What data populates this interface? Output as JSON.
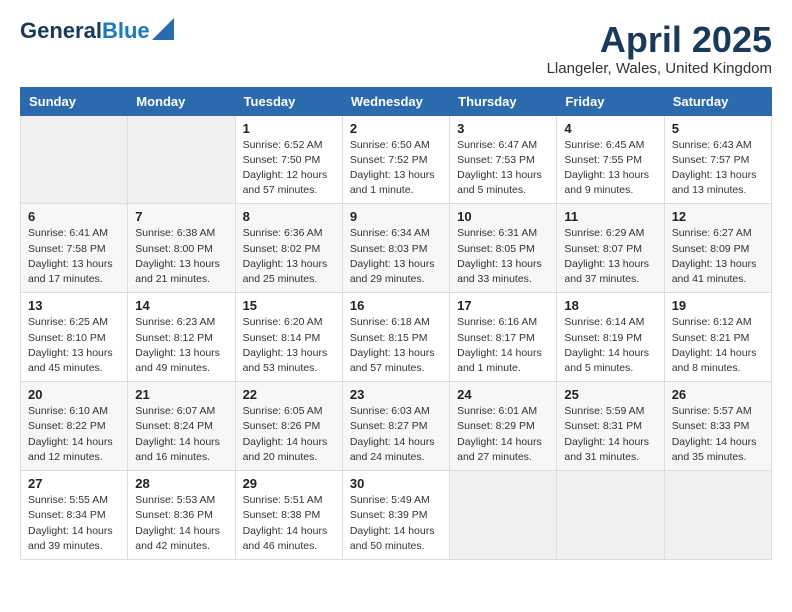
{
  "header": {
    "logo_line1": "General",
    "logo_line2": "Blue",
    "month_title": "April 2025",
    "location": "Llangeler, Wales, United Kingdom"
  },
  "days_of_week": [
    "Sunday",
    "Monday",
    "Tuesday",
    "Wednesday",
    "Thursday",
    "Friday",
    "Saturday"
  ],
  "weeks": [
    [
      {
        "day": "",
        "info": ""
      },
      {
        "day": "",
        "info": ""
      },
      {
        "day": "1",
        "info": "Sunrise: 6:52 AM\nSunset: 7:50 PM\nDaylight: 12 hours\nand 57 minutes."
      },
      {
        "day": "2",
        "info": "Sunrise: 6:50 AM\nSunset: 7:52 PM\nDaylight: 13 hours\nand 1 minute."
      },
      {
        "day": "3",
        "info": "Sunrise: 6:47 AM\nSunset: 7:53 PM\nDaylight: 13 hours\nand 5 minutes."
      },
      {
        "day": "4",
        "info": "Sunrise: 6:45 AM\nSunset: 7:55 PM\nDaylight: 13 hours\nand 9 minutes."
      },
      {
        "day": "5",
        "info": "Sunrise: 6:43 AM\nSunset: 7:57 PM\nDaylight: 13 hours\nand 13 minutes."
      }
    ],
    [
      {
        "day": "6",
        "info": "Sunrise: 6:41 AM\nSunset: 7:58 PM\nDaylight: 13 hours\nand 17 minutes."
      },
      {
        "day": "7",
        "info": "Sunrise: 6:38 AM\nSunset: 8:00 PM\nDaylight: 13 hours\nand 21 minutes."
      },
      {
        "day": "8",
        "info": "Sunrise: 6:36 AM\nSunset: 8:02 PM\nDaylight: 13 hours\nand 25 minutes."
      },
      {
        "day": "9",
        "info": "Sunrise: 6:34 AM\nSunset: 8:03 PM\nDaylight: 13 hours\nand 29 minutes."
      },
      {
        "day": "10",
        "info": "Sunrise: 6:31 AM\nSunset: 8:05 PM\nDaylight: 13 hours\nand 33 minutes."
      },
      {
        "day": "11",
        "info": "Sunrise: 6:29 AM\nSunset: 8:07 PM\nDaylight: 13 hours\nand 37 minutes."
      },
      {
        "day": "12",
        "info": "Sunrise: 6:27 AM\nSunset: 8:09 PM\nDaylight: 13 hours\nand 41 minutes."
      }
    ],
    [
      {
        "day": "13",
        "info": "Sunrise: 6:25 AM\nSunset: 8:10 PM\nDaylight: 13 hours\nand 45 minutes."
      },
      {
        "day": "14",
        "info": "Sunrise: 6:23 AM\nSunset: 8:12 PM\nDaylight: 13 hours\nand 49 minutes."
      },
      {
        "day": "15",
        "info": "Sunrise: 6:20 AM\nSunset: 8:14 PM\nDaylight: 13 hours\nand 53 minutes."
      },
      {
        "day": "16",
        "info": "Sunrise: 6:18 AM\nSunset: 8:15 PM\nDaylight: 13 hours\nand 57 minutes."
      },
      {
        "day": "17",
        "info": "Sunrise: 6:16 AM\nSunset: 8:17 PM\nDaylight: 14 hours\nand 1 minute."
      },
      {
        "day": "18",
        "info": "Sunrise: 6:14 AM\nSunset: 8:19 PM\nDaylight: 14 hours\nand 5 minutes."
      },
      {
        "day": "19",
        "info": "Sunrise: 6:12 AM\nSunset: 8:21 PM\nDaylight: 14 hours\nand 8 minutes."
      }
    ],
    [
      {
        "day": "20",
        "info": "Sunrise: 6:10 AM\nSunset: 8:22 PM\nDaylight: 14 hours\nand 12 minutes."
      },
      {
        "day": "21",
        "info": "Sunrise: 6:07 AM\nSunset: 8:24 PM\nDaylight: 14 hours\nand 16 minutes."
      },
      {
        "day": "22",
        "info": "Sunrise: 6:05 AM\nSunset: 8:26 PM\nDaylight: 14 hours\nand 20 minutes."
      },
      {
        "day": "23",
        "info": "Sunrise: 6:03 AM\nSunset: 8:27 PM\nDaylight: 14 hours\nand 24 minutes."
      },
      {
        "day": "24",
        "info": "Sunrise: 6:01 AM\nSunset: 8:29 PM\nDaylight: 14 hours\nand 27 minutes."
      },
      {
        "day": "25",
        "info": "Sunrise: 5:59 AM\nSunset: 8:31 PM\nDaylight: 14 hours\nand 31 minutes."
      },
      {
        "day": "26",
        "info": "Sunrise: 5:57 AM\nSunset: 8:33 PM\nDaylight: 14 hours\nand 35 minutes."
      }
    ],
    [
      {
        "day": "27",
        "info": "Sunrise: 5:55 AM\nSunset: 8:34 PM\nDaylight: 14 hours\nand 39 minutes."
      },
      {
        "day": "28",
        "info": "Sunrise: 5:53 AM\nSunset: 8:36 PM\nDaylight: 14 hours\nand 42 minutes."
      },
      {
        "day": "29",
        "info": "Sunrise: 5:51 AM\nSunset: 8:38 PM\nDaylight: 14 hours\nand 46 minutes."
      },
      {
        "day": "30",
        "info": "Sunrise: 5:49 AM\nSunset: 8:39 PM\nDaylight: 14 hours\nand 50 minutes."
      },
      {
        "day": "",
        "info": ""
      },
      {
        "day": "",
        "info": ""
      },
      {
        "day": "",
        "info": ""
      }
    ]
  ]
}
